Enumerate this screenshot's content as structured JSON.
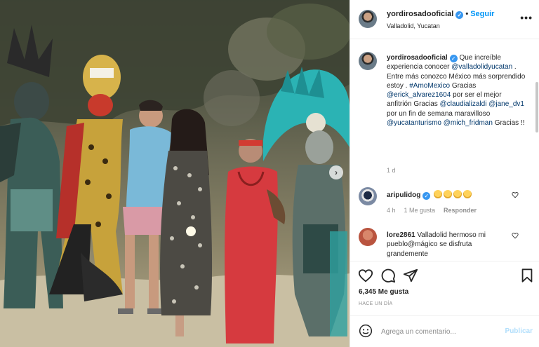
{
  "post": {
    "username": "yordirosadooficial",
    "follow_label": "Seguir",
    "separator": "•",
    "location": "Valladolid, Yucatan",
    "more_label": "•••",
    "next_label": "›"
  },
  "caption": {
    "username": "yordirosadooficial",
    "t1": " Que increíble experiencia conocer ",
    "m1": "@valladolidyucatan",
    "t2": " . Entre más conozco México más sorprendido estoy . ",
    "m2": "#AmoMexico",
    "t3": " Gracias ",
    "m3": "@erick_alvarez1604",
    "t4": " por ser el mejor anfitrión Gracias ",
    "m4": "@claudializaldi",
    "t5": " ",
    "m5": "@jane_dv1",
    "t6": " por un fin de semana maravilloso ",
    "m6": "@yucatanturismo",
    "t7": " ",
    "m7": "@mich_fridman",
    "t8": " Gracias !!",
    "time": "1 d"
  },
  "comments": [
    {
      "username": "aripulidog",
      "text": " ",
      "time": "4 h",
      "likes": "1 Me gusta",
      "reply": "Responder"
    },
    {
      "username": "lore2861",
      "text": " Valladolid hermoso mi pueblo@mágico se disfruta grandemente"
    }
  ],
  "actions": {
    "likes": "6,345 Me gusta",
    "ago": "HACE UN DÍA"
  },
  "comment_box": {
    "placeholder": "Agrega un comentario...",
    "publish": "Publicar"
  },
  "colors": {
    "link": "#00376b",
    "follow": "#0095f6",
    "verified": "#3897f0",
    "publish_disabled": "#b2dffc"
  }
}
